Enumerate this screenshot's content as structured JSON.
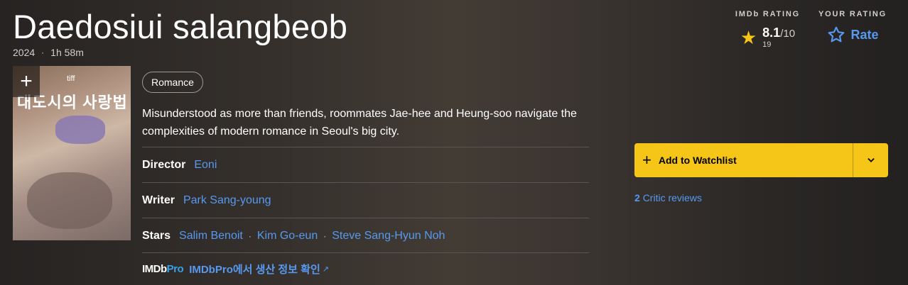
{
  "title": "Daedosiui salangbeob",
  "meta": {
    "year": "2024",
    "runtime": "1h 58m"
  },
  "ratings": {
    "imdb_label": "IMDb RATING",
    "score": "8.1",
    "out_of": "/10",
    "count": "19",
    "your_label": "YOUR RATING",
    "rate_label": "Rate"
  },
  "poster": {
    "korean_title": "대도시의 사랑법",
    "festival": "tiff",
    "add_icon": "plus-icon"
  },
  "genres": [
    "Romance"
  ],
  "description": "Misunderstood as more than friends, roommates Jae-hee and Heung-soo navigate the complexities of modern romance in Seoul's big city.",
  "credits": {
    "director_label": "Director",
    "director": "Eoni",
    "writer_label": "Writer",
    "writer": "Park Sang-young",
    "stars_label": "Stars",
    "stars": [
      "Salim Benoit",
      "Kim Go-eun",
      "Steve Sang-Hyun Noh"
    ]
  },
  "pro": {
    "logo_a": "IMDb",
    "logo_b": "Pro",
    "link": "IMDbPro에서 생산 정보 확인",
    "icon": "external-link-icon"
  },
  "watchlist": {
    "label": "Add to Watchlist",
    "icon": "plus-icon",
    "dropdown_icon": "chevron-down-icon"
  },
  "critic": {
    "count": "2",
    "label": "Critic reviews"
  },
  "colors": {
    "accent": "#f5c518",
    "link": "#5799ef"
  }
}
